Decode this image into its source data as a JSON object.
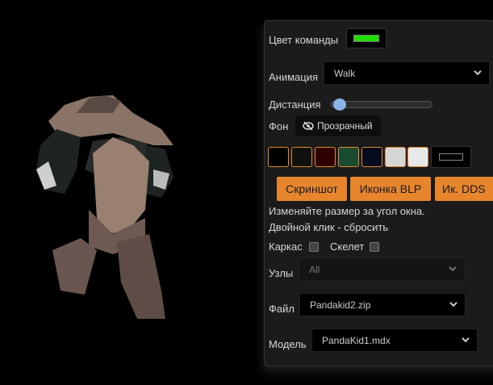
{
  "panel": {
    "team_color_label": "Цвет команды",
    "team_color": "#22dd00",
    "animation_label": "Анимация",
    "animation_value": "Walk",
    "distance_label": "Дистанция",
    "distance_value": 0.03,
    "background_label": "Фон",
    "background_button": "Прозрачный",
    "swatches": [
      "#000000",
      "#111111",
      "#2e0000",
      "#1a4a30",
      "#050b1e",
      "#d6d6d6",
      "#e8e8e8"
    ],
    "buttons": {
      "screenshot": "Скриншот",
      "icon_blp": "Иконка BLP",
      "icon_dds": "Ик. DDS"
    },
    "hint_line1": "Изменяйте размер за угол окна.",
    "hint_line2": "Двойной клик - сбросить",
    "wireframe_label": "Каркас",
    "skeleton_label": "Скелет",
    "nodes_label": "Узлы",
    "nodes_value": "All",
    "file_label": "Файл",
    "file_value": "Pandakid2.zip",
    "model_label": "Модель",
    "model_value": "PandaKid1.mdx",
    "accent": "#e6852c"
  }
}
